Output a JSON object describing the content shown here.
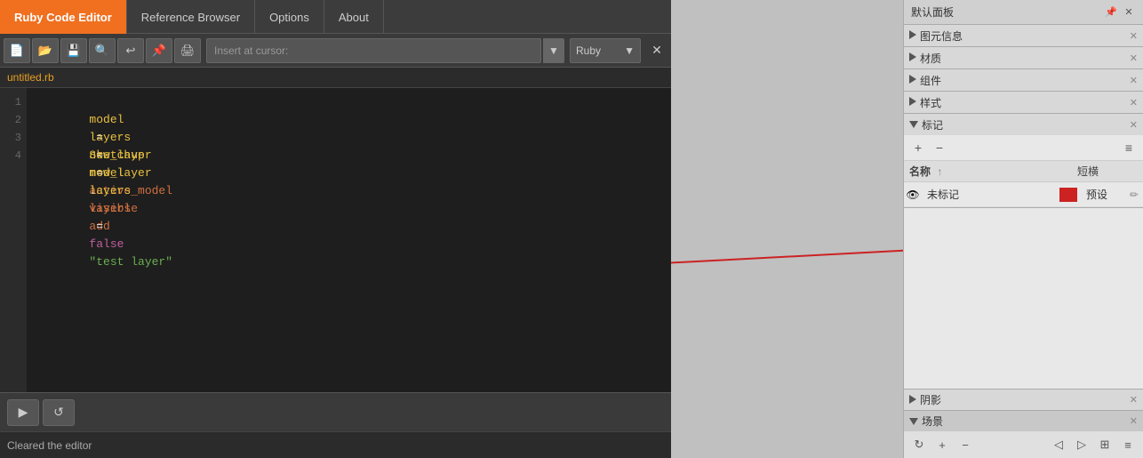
{
  "tabs": {
    "ruby_editor": "Ruby Code Editor",
    "reference_browser": "Reference Browser",
    "options": "Options",
    "about": "About"
  },
  "toolbar": {
    "insert_placeholder": "Insert at cursor:",
    "language": "Ruby",
    "close_symbol": "✕"
  },
  "editor": {
    "filename": "untitled.rb",
    "lines": [
      {
        "num": "1",
        "content": "model = Sketchup.active_model"
      },
      {
        "num": "2",
        "content": "layers = model.layers"
      },
      {
        "num": "3",
        "content": "new_layer = layers.add \"test layer\""
      },
      {
        "num": "4",
        "content": "new_layer.visible = false"
      }
    ]
  },
  "run_toolbar": {
    "run_icon": "▶",
    "clear_icon": "↺"
  },
  "status": {
    "message": "Cleared the editor"
  },
  "right_panel": {
    "title": "默认面板",
    "pin_icon": "📌",
    "close_icon": "✕",
    "sections": {
      "entity_info": "图元信息",
      "materials": "材质",
      "components": "组件",
      "styles": "样式",
      "tags": "标记",
      "shadow": "阴影",
      "scenes": "场景"
    },
    "tags": {
      "plus_icon": "+",
      "minus_icon": "−",
      "detail_icon": "≡",
      "col_name": "名称",
      "col_sort": "↑",
      "col_short": "短横",
      "row_eye": "👁",
      "row_name": "未标记",
      "row_color": "#cc2222",
      "row_short": "预设",
      "row_edit": "✏"
    }
  }
}
